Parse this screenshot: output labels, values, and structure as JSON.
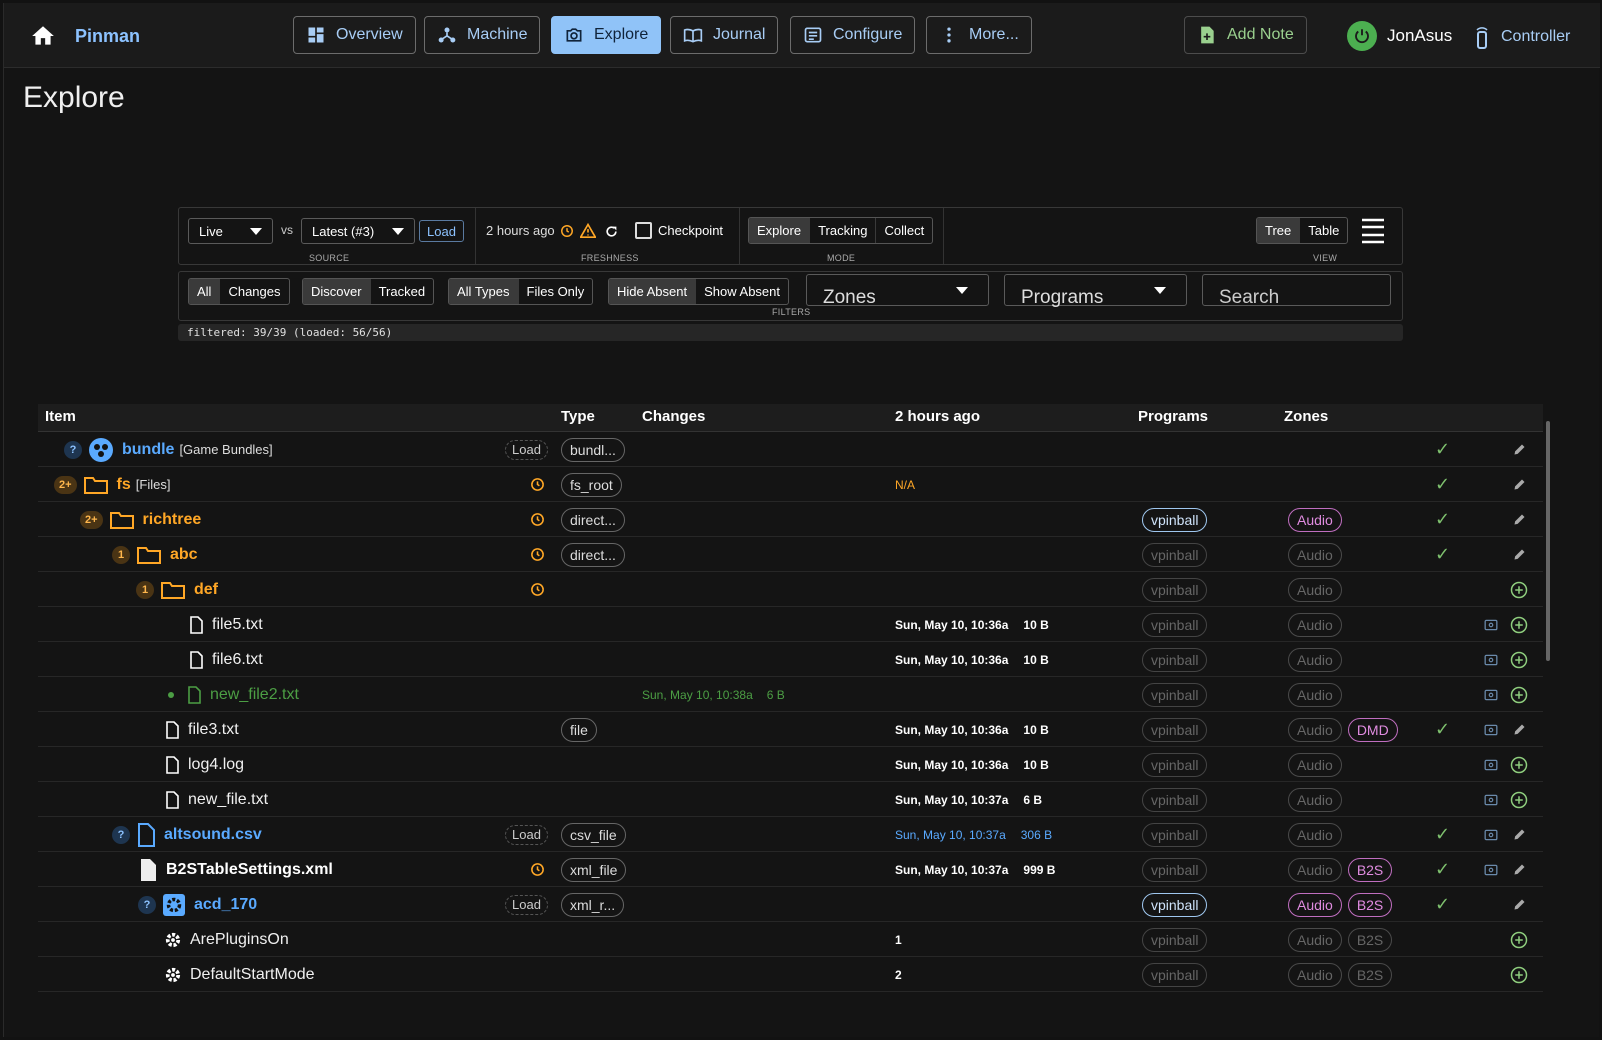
{
  "app": {
    "brand": "Pinman",
    "page_title": "Explore"
  },
  "nav": [
    {
      "label": "Overview",
      "icon": "dashboard-icon"
    },
    {
      "label": "Machine",
      "icon": "hub-icon"
    },
    {
      "label": "Explore",
      "icon": "camera-icon",
      "active": true
    },
    {
      "label": "Journal",
      "icon": "book-icon"
    },
    {
      "label": "Configure",
      "icon": "settings-icon"
    },
    {
      "label": "More...",
      "icon": "more-vert-icon"
    }
  ],
  "header_right": {
    "add_note": "Add Note",
    "user": "JonAsus",
    "controller": "Controller"
  },
  "toolbar": {
    "source_live": "Live",
    "vs": "vs",
    "source_latest": "Latest (#3)",
    "load": "Load",
    "source_label": "SOURCE",
    "freshness_value": "2 hours ago",
    "checkpoint": "Checkpoint",
    "freshness_label": "FRESHNESS",
    "mode": [
      "Explore",
      "Tracking",
      "Collect"
    ],
    "mode_label": "MODE",
    "view": [
      "Tree",
      "Table"
    ],
    "view_label": "VIEW",
    "filter_all": [
      "All",
      "Changes"
    ],
    "filter_track": [
      "Discover",
      "Tracked"
    ],
    "filter_type": [
      "All Types",
      "Files Only"
    ],
    "filter_absent": [
      "Hide Absent",
      "Show Absent"
    ],
    "filters_label": "FILTERS",
    "zones": "Zones",
    "programs": "Programs",
    "search_placeholder": "Search",
    "status": "filtered: 39/39 (loaded: 56/56)"
  },
  "table": {
    "headers": {
      "item": "Item",
      "type": "Type",
      "changes": "Changes",
      "time": "2 hours ago",
      "programs": "Programs",
      "zones": "Zones"
    },
    "rows": [
      {
        "badge": "?",
        "name": "bundle",
        "sub": "[Game Bundles]",
        "load": "Load",
        "type": "bundl...",
        "changes": "",
        "time": "",
        "size": "",
        "prog": "",
        "zones": [],
        "check": true
      },
      {
        "badge": "2+",
        "name": "fs",
        "sub": "[Files]",
        "type": "fs_root",
        "time": "N/A",
        "prog": "",
        "zones": [],
        "check": true
      },
      {
        "badge": "2+",
        "name": "richtree",
        "type": "direct...",
        "prog": "vpinball",
        "zones": [
          "Audio"
        ],
        "check": true
      },
      {
        "badge": "1",
        "name": "abc",
        "type": "direct...",
        "prog": "vpinball",
        "zones": [
          "Audio"
        ],
        "check": true
      },
      {
        "badge": "1",
        "name": "def",
        "prog": "vpinball",
        "zones": [
          "Audio"
        ]
      },
      {
        "name": "file5.txt",
        "time": "Sun, May 10, 10:36a",
        "size": "10 B",
        "prog": "vpinball",
        "zones": [
          "Audio"
        ]
      },
      {
        "name": "file6.txt",
        "time": "Sun, May 10, 10:36a",
        "size": "10 B",
        "prog": "vpinball",
        "zones": [
          "Audio"
        ]
      },
      {
        "name": "new_file2.txt",
        "changes": "Sun, May 10, 10:38a",
        "csize": "6 B",
        "prog": "vpinball",
        "zones": [
          "Audio"
        ]
      },
      {
        "name": "file3.txt",
        "type": "file",
        "time": "Sun, May 10, 10:36a",
        "size": "10 B",
        "prog": "vpinball",
        "zones": [
          "Audio",
          "DMD"
        ],
        "check": true
      },
      {
        "name": "log4.log",
        "time": "Sun, May 10, 10:36a",
        "size": "10 B",
        "prog": "vpinball",
        "zones": [
          "Audio"
        ]
      },
      {
        "name": "new_file.txt",
        "time": "Sun, May 10, 10:37a",
        "size": "6 B",
        "prog": "vpinball",
        "zones": [
          "Audio"
        ]
      },
      {
        "badge": "?",
        "name": "altsound.csv",
        "load": "Load",
        "type": "csv_file",
        "time": "Sun, May 10, 10:37a",
        "size": "306 B",
        "prog": "vpinball",
        "zones": [
          "Audio"
        ],
        "check": true
      },
      {
        "name": "B2STableSettings.xml",
        "type": "xml_file",
        "time": "Sun, May 10, 10:37a",
        "size": "999 B",
        "prog": "vpinball",
        "zones": [
          "Audio",
          "B2S"
        ],
        "check": true
      },
      {
        "badge": "?",
        "name": "acd_170",
        "load": "Load",
        "type": "xml_r...",
        "prog": "vpinball",
        "zones": [
          "Audio",
          "B2S"
        ],
        "check": true
      },
      {
        "name": "ArePluginsOn",
        "time": "1",
        "prog": "vpinball",
        "zones": [
          "Audio",
          "B2S"
        ]
      },
      {
        "name": "DefaultStartMode",
        "time": "2",
        "prog": "vpinball",
        "zones": [
          "Audio",
          "B2S"
        ]
      }
    ]
  },
  "colors": {
    "accent": "#90c3f8",
    "orange": "#ffa726",
    "green": "#4c9e44",
    "blue": "#5aaaff",
    "zone": "#e08ce0"
  }
}
